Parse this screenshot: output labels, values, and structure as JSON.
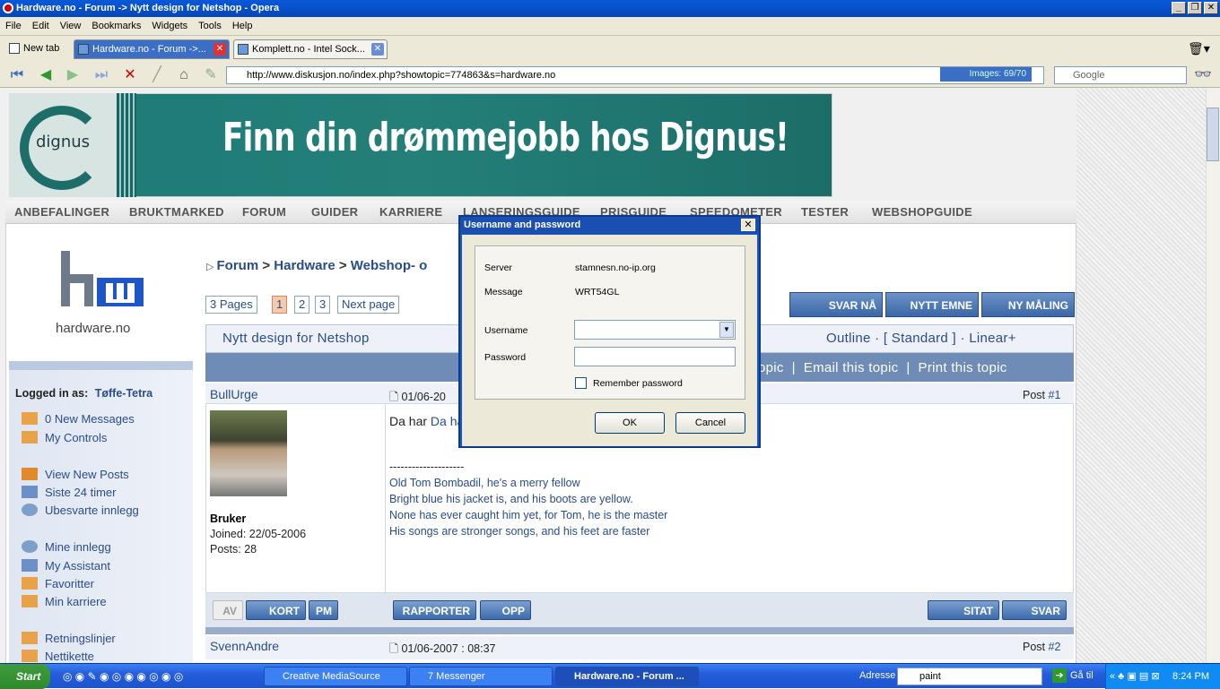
{
  "window": {
    "title": "Hardware.no - Forum -> Nytt design for Netshop - Opera"
  },
  "menu": [
    "File",
    "Edit",
    "View",
    "Bookmarks",
    "Widgets",
    "Tools",
    "Help"
  ],
  "tabs": {
    "new_tab": "New tab",
    "items": [
      "Hardware.no - Forum ->...",
      "Komplett.no - Intel Sock..."
    ]
  },
  "nav": {
    "url": "http://www.diskusjon.no/index.php?showtopic=774863&s=hardware.no",
    "images": "Images:   69/70",
    "search_placeholder": "Google"
  },
  "banner": {
    "logo": "dignus",
    "text": "Finn din drømmejobb hos Dignus!"
  },
  "topnav": [
    "ANBEFALINGER",
    "BRUKTMARKED",
    "FORUM",
    "GUIDER",
    "KARRIERE",
    "LANSERINGSGUIDE",
    "PRISGUIDE",
    "SPEEDOMETER",
    "TESTER",
    "WEBSHOPGUIDE"
  ],
  "sidebar": {
    "logo_text": "hardware.no",
    "logged_in_label": "Logged in as:",
    "username": "Tøffe-Tetra",
    "items": [
      "0 New Messages",
      "My Controls",
      "View New Posts",
      "Siste 24 timer",
      "Ubesvarte innlegg",
      "Mine innlegg",
      "My Assistant",
      "Favoritter",
      "Min karriere",
      "Retningslinjer",
      "Nettikette"
    ]
  },
  "breadcrumb": {
    "parts": [
      "Forum",
      "Hardware",
      "Webshop- o"
    ]
  },
  "pagination": {
    "pages": "3 Pages",
    "p1": "1",
    "p2": "2",
    "p3": "3",
    "next": "Next page"
  },
  "actions": {
    "reply": "SVAR NÅ",
    "new_topic": "NYTT EMNE",
    "poll": "NY MÅLING"
  },
  "thread": {
    "title": "Nytt design for Netshop",
    "modes": "Outline · [ Standard ] · Linear+",
    "tools": "opic  |  Email this topic  |  Print this topic"
  },
  "post1": {
    "author": "BullUrge",
    "date": "01/06-20",
    "number_label": "Post",
    "number": "#1",
    "rank": "Bruker",
    "joined": "Joined: 22/05-2006",
    "posts": "Posts: 28",
    "text": "Da har Net",
    "sig_line": "--------------------",
    "sig": [
      "Old Tom Bombadil, he's a merry fellow",
      "Bright blue his jacket is, and his boots are yellow.",
      "None has ever caught him yet, for Tom, he is the master",
      "His songs are stronger songs, and his feet are faster"
    ],
    "btns": {
      "av": "AV",
      "kort": "KORT",
      "pm": "PM",
      "rapporter": "RAPPORTER",
      "opp": "OPP",
      "sitat": "SITAT",
      "svar": "SVAR"
    }
  },
  "post2": {
    "author": "SvennAndre",
    "date": "01/06-2007 : 08:37",
    "number_label": "Post",
    "number": "#2"
  },
  "dialog": {
    "title": "Username and password",
    "server_label": "Server",
    "server": "stamnesn.no-ip.org",
    "message_label": "Message",
    "message": "WRT54GL",
    "username_label": "Username",
    "password_label": "Password",
    "remember": "Remember password",
    "ok": "OK",
    "cancel": "Cancel"
  },
  "taskbar": {
    "start": "Start",
    "tasks": [
      "Creative MediaSource",
      "7 Messenger",
      "Hardware.no - Forum ..."
    ],
    "address_label": "Adresse",
    "address_value": "paint",
    "go": "Gå til",
    "clock": "8:24 PM"
  }
}
